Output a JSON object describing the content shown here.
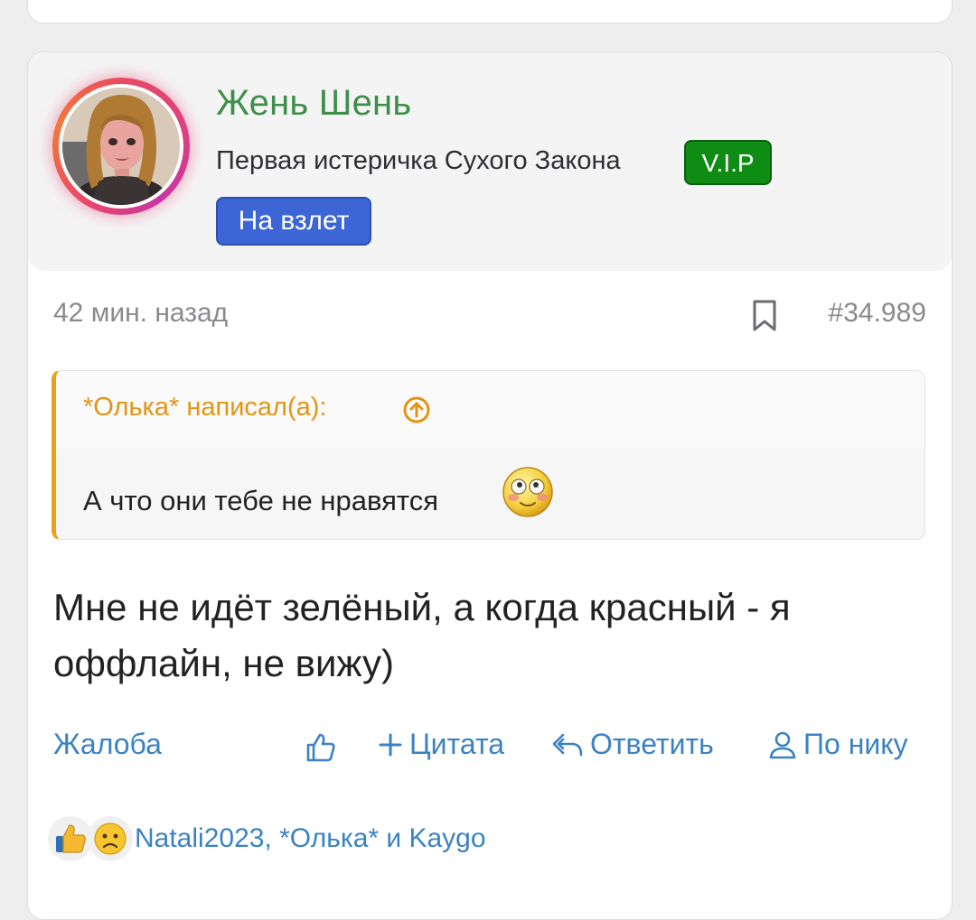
{
  "post": {
    "author": {
      "name": "Жень Шень",
      "title": "Первая истеричка Сухого Закона",
      "badges": [
        "V.I.P",
        "На взлет"
      ],
      "avatar_icon": "avatar-woman-illustration"
    },
    "meta": {
      "time": "42 мин. назад",
      "post_number": "#34.989",
      "bookmark_icon": "bookmark-icon"
    },
    "quote": {
      "author_line": "*Олька* написал(а):",
      "text": "А что они тебе не нравятся",
      "emoji": "smiley-blush-icon"
    },
    "message": "Мне не идёт зелёный, а когда красный - я оффлайн, не вижу)",
    "actions": {
      "report": "Жалоба",
      "quote": "Цитата",
      "reply": "Ответить",
      "by_nick": "По нику"
    },
    "reactions": {
      "icons": [
        "thumbs-up-icon",
        "sad-face-icon"
      ],
      "names": "Natali2023, *Олька* и Kaygo"
    }
  },
  "colors": {
    "username": "#3f8f4b",
    "vip": "#0f8c13",
    "rank": "#3c66d6",
    "link": "#3b82c4",
    "quote_accent": "#e8a21a"
  }
}
